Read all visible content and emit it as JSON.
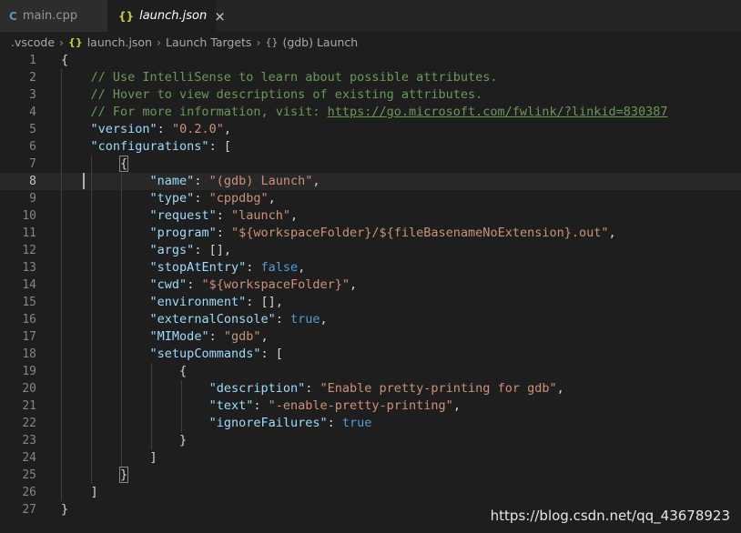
{
  "tabs": [
    {
      "label": "main.cpp",
      "icon": "cpp-file-icon",
      "active": false
    },
    {
      "label": "launch.json",
      "icon": "json-file-icon",
      "active": true,
      "close_glyph": "×"
    }
  ],
  "breadcrumb": [
    ".vscode",
    "launch.json",
    "Launch Targets",
    "(gdb) Launch"
  ],
  "breadcrumb_icons": {
    "json": "{}",
    "object": "{}"
  },
  "tab_icons": {
    "cpp": "C",
    "json": "{}"
  },
  "editor": {
    "current_line": 8,
    "lines": [
      {
        "n": "1",
        "tokens": [
          {
            "t": "p",
            "v": "{"
          }
        ]
      },
      {
        "n": "2",
        "tokens": [
          {
            "t": "c",
            "v": "    // Use IntelliSense to learn about possible attributes."
          }
        ]
      },
      {
        "n": "3",
        "tokens": [
          {
            "t": "c",
            "v": "    // Hover to view descriptions of existing attributes."
          }
        ]
      },
      {
        "n": "4",
        "tokens": [
          {
            "t": "c",
            "v": "    // For more information, visit: "
          },
          {
            "t": "u",
            "v": "https://go.microsoft.com/fwlink/?linkid=830387"
          }
        ]
      },
      {
        "n": "5",
        "tokens": [
          {
            "t": "p",
            "v": "    "
          },
          {
            "t": "k",
            "v": "\"version\""
          },
          {
            "t": "p",
            "v": ": "
          },
          {
            "t": "s",
            "v": "\"0.2.0\""
          },
          {
            "t": "p",
            "v": ","
          }
        ]
      },
      {
        "n": "6",
        "tokens": [
          {
            "t": "p",
            "v": "    "
          },
          {
            "t": "k",
            "v": "\"configurations\""
          },
          {
            "t": "p",
            "v": ": ["
          }
        ]
      },
      {
        "n": "7",
        "tokens": [
          {
            "t": "p",
            "v": "        "
          },
          {
            "t": "m",
            "v": "{"
          }
        ]
      },
      {
        "n": "8",
        "tokens": [
          {
            "t": "p",
            "v": "            "
          },
          {
            "t": "k",
            "v": "\"name\""
          },
          {
            "t": "p",
            "v": ": "
          },
          {
            "t": "s",
            "v": "\"(gdb) Launch\""
          },
          {
            "t": "p",
            "v": ","
          }
        ]
      },
      {
        "n": "9",
        "tokens": [
          {
            "t": "p",
            "v": "            "
          },
          {
            "t": "k",
            "v": "\"type\""
          },
          {
            "t": "p",
            "v": ": "
          },
          {
            "t": "s",
            "v": "\"cppdbg\""
          },
          {
            "t": "p",
            "v": ","
          }
        ]
      },
      {
        "n": "10",
        "tokens": [
          {
            "t": "p",
            "v": "            "
          },
          {
            "t": "k",
            "v": "\"request\""
          },
          {
            "t": "p",
            "v": ": "
          },
          {
            "t": "s",
            "v": "\"launch\""
          },
          {
            "t": "p",
            "v": ","
          }
        ]
      },
      {
        "n": "11",
        "tokens": [
          {
            "t": "p",
            "v": "            "
          },
          {
            "t": "k",
            "v": "\"program\""
          },
          {
            "t": "p",
            "v": ": "
          },
          {
            "t": "s",
            "v": "\"${workspaceFolder}/${fileBasenameNoExtension}.out\""
          },
          {
            "t": "p",
            "v": ","
          }
        ]
      },
      {
        "n": "12",
        "tokens": [
          {
            "t": "p",
            "v": "            "
          },
          {
            "t": "k",
            "v": "\"args\""
          },
          {
            "t": "p",
            "v": ": [],"
          }
        ]
      },
      {
        "n": "13",
        "tokens": [
          {
            "t": "p",
            "v": "            "
          },
          {
            "t": "k",
            "v": "\"stopAtEntry\""
          },
          {
            "t": "p",
            "v": ": "
          },
          {
            "t": "b",
            "v": "false"
          },
          {
            "t": "p",
            "v": ","
          }
        ]
      },
      {
        "n": "14",
        "tokens": [
          {
            "t": "p",
            "v": "            "
          },
          {
            "t": "k",
            "v": "\"cwd\""
          },
          {
            "t": "p",
            "v": ": "
          },
          {
            "t": "s",
            "v": "\"${workspaceFolder}\""
          },
          {
            "t": "p",
            "v": ","
          }
        ]
      },
      {
        "n": "15",
        "tokens": [
          {
            "t": "p",
            "v": "            "
          },
          {
            "t": "k",
            "v": "\"environment\""
          },
          {
            "t": "p",
            "v": ": [],"
          }
        ]
      },
      {
        "n": "16",
        "tokens": [
          {
            "t": "p",
            "v": "            "
          },
          {
            "t": "k",
            "v": "\"externalConsole\""
          },
          {
            "t": "p",
            "v": ": "
          },
          {
            "t": "b",
            "v": "true"
          },
          {
            "t": "p",
            "v": ","
          }
        ]
      },
      {
        "n": "17",
        "tokens": [
          {
            "t": "p",
            "v": "            "
          },
          {
            "t": "k",
            "v": "\"MIMode\""
          },
          {
            "t": "p",
            "v": ": "
          },
          {
            "t": "s",
            "v": "\"gdb\""
          },
          {
            "t": "p",
            "v": ","
          }
        ]
      },
      {
        "n": "18",
        "tokens": [
          {
            "t": "p",
            "v": "            "
          },
          {
            "t": "k",
            "v": "\"setupCommands\""
          },
          {
            "t": "p",
            "v": ": ["
          }
        ]
      },
      {
        "n": "19",
        "tokens": [
          {
            "t": "p",
            "v": "                {"
          }
        ]
      },
      {
        "n": "20",
        "tokens": [
          {
            "t": "p",
            "v": "                    "
          },
          {
            "t": "k",
            "v": "\"description\""
          },
          {
            "t": "p",
            "v": ": "
          },
          {
            "t": "s",
            "v": "\"Enable pretty-printing for gdb\""
          },
          {
            "t": "p",
            "v": ","
          }
        ]
      },
      {
        "n": "21",
        "tokens": [
          {
            "t": "p",
            "v": "                    "
          },
          {
            "t": "k",
            "v": "\"text\""
          },
          {
            "t": "p",
            "v": ": "
          },
          {
            "t": "s",
            "v": "\"-enable-pretty-printing\""
          },
          {
            "t": "p",
            "v": ","
          }
        ]
      },
      {
        "n": "22",
        "tokens": [
          {
            "t": "p",
            "v": "                    "
          },
          {
            "t": "k",
            "v": "\"ignoreFailures\""
          },
          {
            "t": "p",
            "v": ": "
          },
          {
            "t": "b",
            "v": "true"
          }
        ]
      },
      {
        "n": "23",
        "tokens": [
          {
            "t": "p",
            "v": "                }"
          }
        ]
      },
      {
        "n": "24",
        "tokens": [
          {
            "t": "p",
            "v": "            ]"
          }
        ]
      },
      {
        "n": "25",
        "tokens": [
          {
            "t": "p",
            "v": "        "
          },
          {
            "t": "m",
            "v": "}"
          }
        ]
      },
      {
        "n": "26",
        "tokens": [
          {
            "t": "p",
            "v": "    ]"
          }
        ]
      },
      {
        "n": "27",
        "tokens": [
          {
            "t": "p",
            "v": "}"
          }
        ]
      }
    ]
  },
  "watermark": "https://blog.csdn.net/qq_43678923",
  "colors": {
    "background": "#1e1e1e",
    "key": "#9cdcfe",
    "string": "#ce9178",
    "comment": "#6a9955",
    "boolean": "#569cd6"
  }
}
